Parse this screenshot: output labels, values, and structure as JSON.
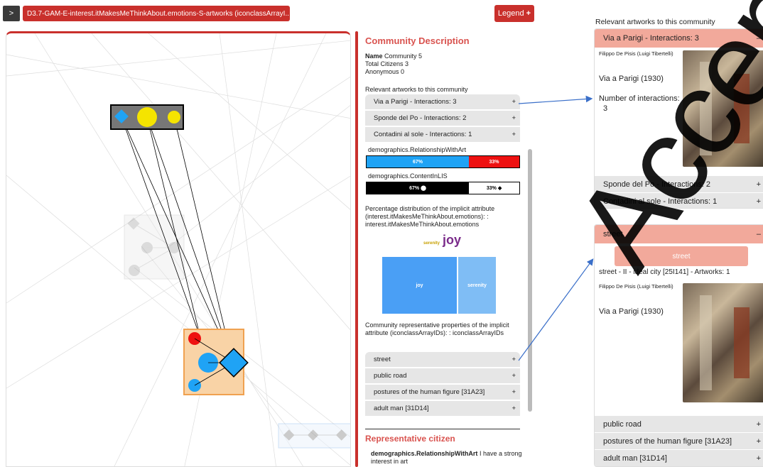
{
  "topbar": {
    "toggle_label": ">",
    "dataset_label": "D3.7-GAM-E-interest.itMakesMeThinkAbout.emotions-S-artworks (iconclassArrayI..",
    "dataset_caret": "▾",
    "legend_label": "Legend",
    "legend_plus": "+"
  },
  "description": {
    "title": "Community Description",
    "name_label": "Name",
    "name_value": "Community 5",
    "total_citizens": "Total Citizens 3",
    "anonymous": "Anonymous 0",
    "artworks_label": "Relevant artworks to this community",
    "artworks": [
      {
        "label": "Via a Parigi - Interactions: 3",
        "icon": "+"
      },
      {
        "label": "Sponde del Po - Interactions: 2",
        "icon": "+"
      },
      {
        "label": "Contadini al sole - Interactions: 1",
        "icon": "+"
      }
    ],
    "demo1": {
      "label": "demographics.RelationshipWithArt",
      "left_pct": "67%",
      "right_pct": "33%",
      "left_fraction": 0.67,
      "left_color": "#1fa3f5",
      "right_color": "#ee1111"
    },
    "demo2": {
      "label": "demographics.ContentInLIS",
      "left_pct": "67%",
      "right_pct": "33%",
      "left_fraction": 0.67,
      "left_symbol": "⬤",
      "right_symbol": "◆"
    },
    "implicit_text": "Percentage distribution of the implicit attribute (interest.itMakesMeThinkAbout.emotions): : interest.itMakesMeThinkAbout.emotions",
    "wordcloud": {
      "small": "serenity",
      "big": "joy"
    },
    "treemap": {
      "joy": "joy",
      "serenity": "serenity"
    },
    "representative_props": "Community representative properties of the implicit attribute (iconclassArrayIDs): : iconclassArrayIDs",
    "properties": [
      {
        "label": "street",
        "icon": "+"
      },
      {
        "label": "public road",
        "icon": "+"
      },
      {
        "label": "postures of the human figure [31A23]",
        "icon": "+"
      },
      {
        "label": "adult man [31D14]",
        "icon": "+"
      }
    ],
    "rep_title": "Representative citizen",
    "rep_key": "demographics.RelationshipWithArt",
    "rep_value": "I have a strong interest in art"
  },
  "side": {
    "artworks_label": "Relevant artworks to this community",
    "artwork_header": "Via a Parigi - Interactions: 3",
    "header_icon": "–",
    "artist": "Filippo De Pisis (Luigi Tibertelli)",
    "title": "Via a Parigi  (1930)",
    "interactions_label": "Number of interactions:",
    "interactions_value": "3",
    "other_artworks": [
      {
        "label": "Sponde del Po - Interactions: 2",
        "icon": "+"
      },
      {
        "label": "Contadini al sole - Interactions: 1",
        "icon": "+"
      }
    ],
    "street_header": "street",
    "street_button": "street",
    "street_line": "street - II - ideal city [25I141] - Artworks: 1",
    "street_artist": "Filippo De Pisis (Luigi Tibertelli)",
    "street_title": "Via a Parigi  (1930)",
    "other_props": [
      {
        "label": "public road",
        "icon": "+"
      },
      {
        "label": "postures of the human figure [31A23]",
        "icon": "+"
      },
      {
        "label": "adult man [31D14]",
        "icon": "+"
      }
    ]
  },
  "watermark": "Accepted",
  "colors": {
    "accent_red": "#c9302c",
    "heading_red": "#d9534f",
    "salmon": "#f2a99b",
    "node_blue": "#1fa3f5",
    "node_yellow": "#f5e400",
    "node_red": "#ee1111"
  }
}
